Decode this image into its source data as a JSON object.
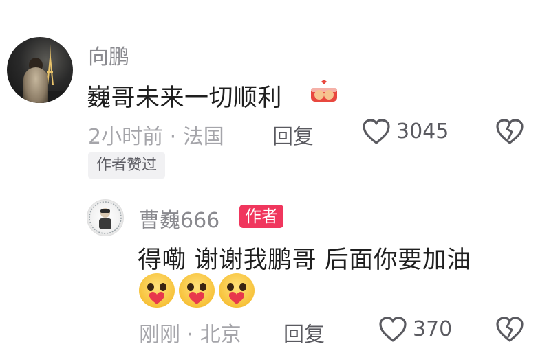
{
  "comment": {
    "username": "向鹏",
    "text": "巍哥未来一切顺利",
    "sticker_icon": "fist-bump-sticker",
    "meta": "2小时前 · 法国",
    "reply_label": "回复",
    "like_count": "3045",
    "author_liked_tag": "作者赞过"
  },
  "reply": {
    "username": "曹巍666",
    "author_badge": "作者",
    "text": "得嘞 谢谢我鹏哥 后面你要加油",
    "emoji_count": 3,
    "emoji_icon": "heart-hug-emoji",
    "meta": "刚刚 · 北京",
    "reply_label": "回复",
    "like_count": "370"
  },
  "colors": {
    "author_badge_bg": "#f0365d",
    "meta_text": "#a5a5aa",
    "primary_text": "#1f1f1f"
  }
}
